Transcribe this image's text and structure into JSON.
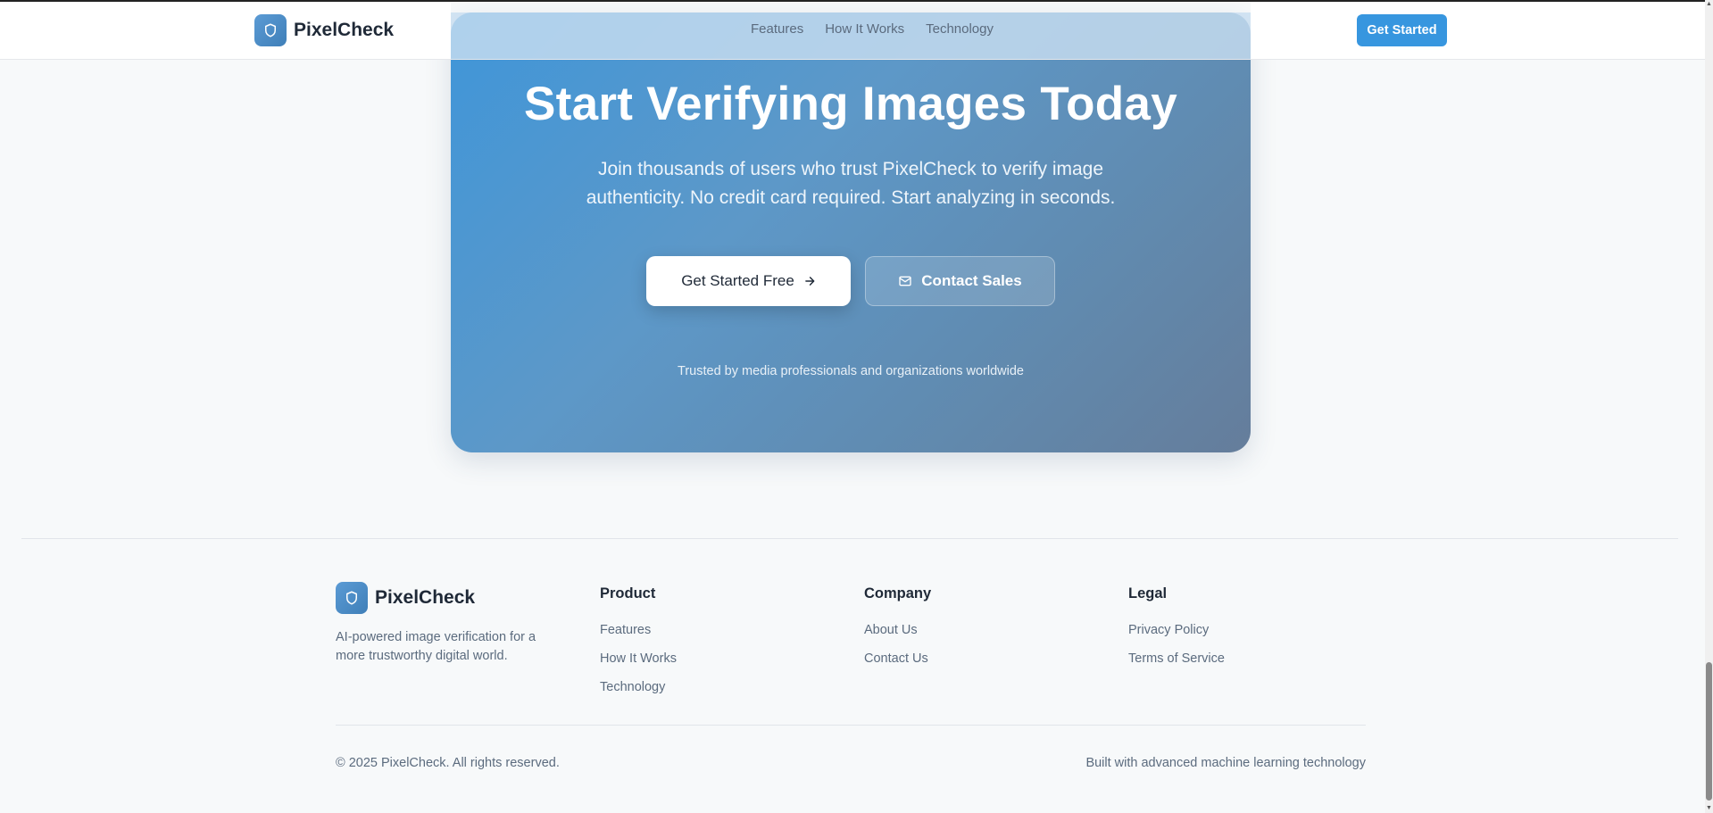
{
  "header": {
    "brand": "PixelCheck",
    "nav": [
      "Features",
      "How It Works",
      "Technology"
    ],
    "cta_label": "Get Started"
  },
  "cta": {
    "title": "Start Verifying Images Today",
    "subtitle": "Join thousands of users who trust PixelCheck to verify image authenticity. No credit card required. Start analyzing in seconds.",
    "primary_label": "Get Started Free",
    "secondary_label": "Contact Sales",
    "trusted": "Trusted by media professionals and organizations worldwide"
  },
  "footer": {
    "brand": "PixelCheck",
    "description": "AI-powered image verification for a more trustworthy digital world.",
    "columns": [
      {
        "heading": "Product",
        "links": [
          "Features",
          "How It Works",
          "Technology"
        ]
      },
      {
        "heading": "Company",
        "links": [
          "About Us",
          "Contact Us"
        ]
      },
      {
        "heading": "Legal",
        "links": [
          "Privacy Policy",
          "Terms of Service"
        ]
      }
    ],
    "copyright": "© 2025 PixelCheck. All rights reserved.",
    "built_with": "Built with advanced machine learning technology"
  },
  "icons": {
    "logo": "shield-icon",
    "primary_button": "arrow-right-icon",
    "secondary_button": "mail-icon"
  },
  "colors": {
    "accent": "#3796df",
    "cta_gradient_start": "#3f96d9",
    "cta_gradient_end": "#657d9b",
    "text_muted": "#5b6b7e"
  }
}
